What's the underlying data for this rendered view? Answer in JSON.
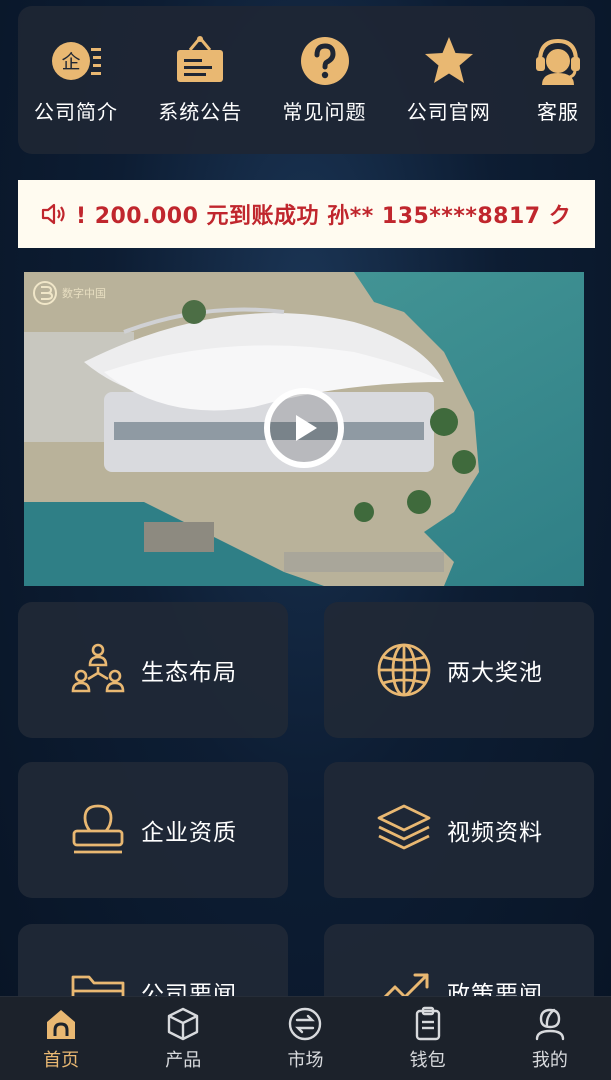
{
  "colors": {
    "accent": "#e9b872",
    "notice_text": "#c0262d",
    "tile_bg": "#202836",
    "nav_bg": "#1c222b"
  },
  "quick_links": [
    {
      "label": "公司简介",
      "icon": "company-icon",
      "badge": "企"
    },
    {
      "label": "系统公告",
      "icon": "announcement-icon"
    },
    {
      "label": "常见问题",
      "icon": "question-icon"
    },
    {
      "label": "公司官网",
      "icon": "star-icon"
    },
    {
      "label": "客服",
      "icon": "customer-service-icon"
    }
  ],
  "notice": {
    "icon": "speaker-icon",
    "text": "! 200.000 元到账成功 孙** 135****8817 ク"
  },
  "video": {
    "logo_text": "数字中国",
    "play_icon": "play-icon"
  },
  "tiles": [
    {
      "label": "生态布局",
      "icon": "ecosystem-icon"
    },
    {
      "label": "两大奖池",
      "icon": "globe-icon"
    },
    {
      "label": "企业资质",
      "icon": "stamp-icon"
    },
    {
      "label": "视频资料",
      "icon": "layers-icon"
    },
    {
      "label": "公司要闻",
      "icon": "folder-icon"
    },
    {
      "label": "政策要闻",
      "icon": "trend-icon"
    }
  ],
  "bottom_nav": [
    {
      "label": "首页",
      "icon": "home-icon",
      "active": true
    },
    {
      "label": "产品",
      "icon": "product-icon",
      "active": false
    },
    {
      "label": "市场",
      "icon": "market-icon",
      "active": false
    },
    {
      "label": "钱包",
      "icon": "wallet-icon",
      "active": false
    },
    {
      "label": "我的",
      "icon": "profile-icon",
      "active": false
    }
  ]
}
